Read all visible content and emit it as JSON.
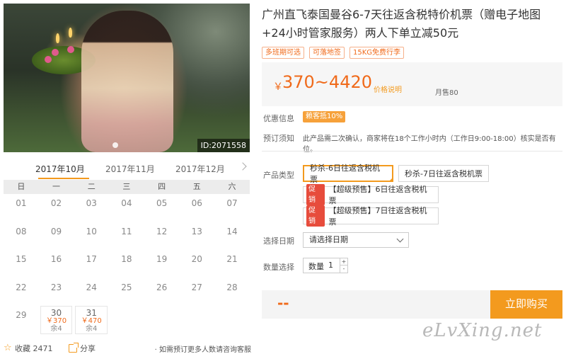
{
  "photo": {
    "id_label": "ID:2071558"
  },
  "calendar": {
    "months": [
      "2017年10月",
      "2017年11月",
      "2017年12月"
    ],
    "weekdays": [
      "日",
      "一",
      "二",
      "三",
      "四",
      "五",
      "六"
    ],
    "days": [
      "01",
      "02",
      "03",
      "04",
      "05",
      "06",
      "07",
      "08",
      "09",
      "10",
      "11",
      "12",
      "13",
      "14",
      "15",
      "16",
      "17",
      "18",
      "19",
      "20",
      "21",
      "22",
      "23",
      "24",
      "25",
      "26",
      "27",
      "28",
      "29"
    ],
    "avail": [
      {
        "day": "30",
        "price": "￥370",
        "remain": "余4"
      },
      {
        "day": "31",
        "price": "￥470",
        "remain": "余4"
      }
    ]
  },
  "bottom": {
    "favorite": "收藏 2471",
    "share": "分享",
    "note": "· 如需预订更多人数请咨询客服"
  },
  "product": {
    "title": "广州直飞泰国曼谷6-7天往返含税特价机票（赠电子地图+24小时管家服务）两人下单立减50元",
    "tags": [
      "多班期可选",
      "可落地签",
      "15KG免费行李"
    ],
    "price_symbol": "￥",
    "price_range": "370~4420",
    "price_explain": "价格说明",
    "monthly_sales": "月售80"
  },
  "info": {
    "promo_label": "优惠信息",
    "promo_badge": "赖客抵10%",
    "notice_label": "预订须知",
    "notice_text": "此产品需二次确认，商家将在18个工作小时内（工作日9:00-18:00）核实是否有位。"
  },
  "product_type": {
    "label": "产品类型",
    "options": [
      "秒杀-6日往返含税机票",
      "秒杀-7日往返含税机票"
    ],
    "sale_badge": "促销",
    "presale_options": [
      "【超级预售】6日往返含税机票",
      "【超级预售】7日往返含税机票"
    ]
  },
  "date_select": {
    "label": "选择日期",
    "placeholder": "请选择日期"
  },
  "quantity": {
    "label": "数量选择",
    "field_label": "数量",
    "value": "1",
    "plus": "+",
    "minus": "-"
  },
  "buy": {
    "total": "--",
    "button": "立即购买"
  },
  "watermark": "eLvXing.net"
}
